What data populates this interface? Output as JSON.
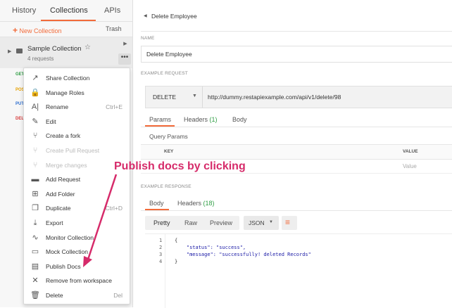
{
  "sidebar": {
    "tabs": [
      {
        "label": "History"
      },
      {
        "label": "Collections"
      },
      {
        "label": "APIs"
      }
    ],
    "new_collection": "New Collection",
    "new_collection_plus": "+",
    "trash": "Trash",
    "collection": {
      "name": "Sample Collection",
      "count": "4 requests"
    },
    "methods": [
      {
        "label": "GET",
        "color": "#2f9e44"
      },
      {
        "label": "POS",
        "color": "#e6a100"
      },
      {
        "label": "PUT",
        "color": "#2f6fcf"
      },
      {
        "label": "DEL",
        "color": "#d63a3a"
      }
    ]
  },
  "menu": {
    "items": [
      {
        "label": "Share Collection",
        "icon": "share-icon",
        "glyph": "↗",
        "disabled": false,
        "shortcut": ""
      },
      {
        "label": "Manage Roles",
        "icon": "lock-icon",
        "glyph": "🔒",
        "disabled": false,
        "shortcut": ""
      },
      {
        "label": "Rename",
        "icon": "rename-icon",
        "glyph": "A|",
        "disabled": false,
        "shortcut": "Ctrl+E"
      },
      {
        "label": "Edit",
        "icon": "pencil-icon",
        "glyph": "✎",
        "disabled": false,
        "shortcut": ""
      },
      {
        "label": "Create a fork",
        "icon": "fork-icon",
        "glyph": "⑂",
        "disabled": false,
        "shortcut": ""
      },
      {
        "label": "Create Pull Request",
        "icon": "pull-request-icon",
        "glyph": "⑂",
        "disabled": true,
        "shortcut": ""
      },
      {
        "label": "Merge changes",
        "icon": "merge-icon",
        "glyph": "⑂",
        "disabled": true,
        "shortcut": ""
      },
      {
        "label": "Add Request",
        "icon": "add-request-icon",
        "glyph": "▬",
        "disabled": false,
        "shortcut": ""
      },
      {
        "label": "Add Folder",
        "icon": "add-folder-icon",
        "glyph": "⊞",
        "disabled": false,
        "shortcut": ""
      },
      {
        "label": "Duplicate",
        "icon": "duplicate-icon",
        "glyph": "❐",
        "disabled": false,
        "shortcut": "Ctrl+D"
      },
      {
        "label": "Export",
        "icon": "export-icon",
        "glyph": "⤓",
        "disabled": false,
        "shortcut": ""
      },
      {
        "label": "Monitor Collection",
        "icon": "monitor-icon",
        "glyph": "∿",
        "disabled": false,
        "shortcut": ""
      },
      {
        "label": "Mock Collection",
        "icon": "mock-icon",
        "glyph": "▭",
        "disabled": false,
        "shortcut": ""
      },
      {
        "label": "Publish Docs",
        "icon": "publish-docs-icon",
        "glyph": "▤",
        "disabled": false,
        "shortcut": ""
      },
      {
        "label": "Remove from workspace",
        "icon": "remove-icon",
        "glyph": "✕",
        "disabled": false,
        "shortcut": ""
      },
      {
        "label": "Delete",
        "icon": "trash-icon",
        "glyph": "🗑",
        "disabled": false,
        "shortcut": "Del"
      }
    ]
  },
  "main": {
    "breadcrumb": "Delete Employee",
    "name_label": "NAME",
    "name_value": "Delete Employee",
    "example_request_label": "EXAMPLE REQUEST",
    "method": "DELETE",
    "url": "http://dummy.restapiexample.com/api/v1/delete/98",
    "req_tabs": {
      "params": "Params",
      "headers": "Headers",
      "headers_count": "(1)",
      "body": "Body"
    },
    "query_params": "Query Params",
    "kv": {
      "key": "KEY",
      "value": "VALUE",
      "value_placeholder": "Value"
    },
    "example_response_label": "EXAMPLE RESPONSE",
    "resp_tabs": {
      "body": "Body",
      "headers": "Headers",
      "headers_count": "(18)"
    },
    "view_modes": {
      "pretty": "Pretty",
      "raw": "Raw",
      "preview": "Preview"
    },
    "format": "JSON",
    "code_lines": [
      {
        "n": "1",
        "text": "{"
      },
      {
        "n": "2",
        "text": "    \"status\": \"success\","
      },
      {
        "n": "3",
        "text": "    \"message\": \"successfully! deleted Records\""
      },
      {
        "n": "4",
        "text": "}"
      }
    ]
  },
  "annotation": "Publish docs by clicking",
  "colors": {
    "accent": "#f26b3a",
    "annotation": "#d62b6a",
    "green": "#2f9e44"
  }
}
